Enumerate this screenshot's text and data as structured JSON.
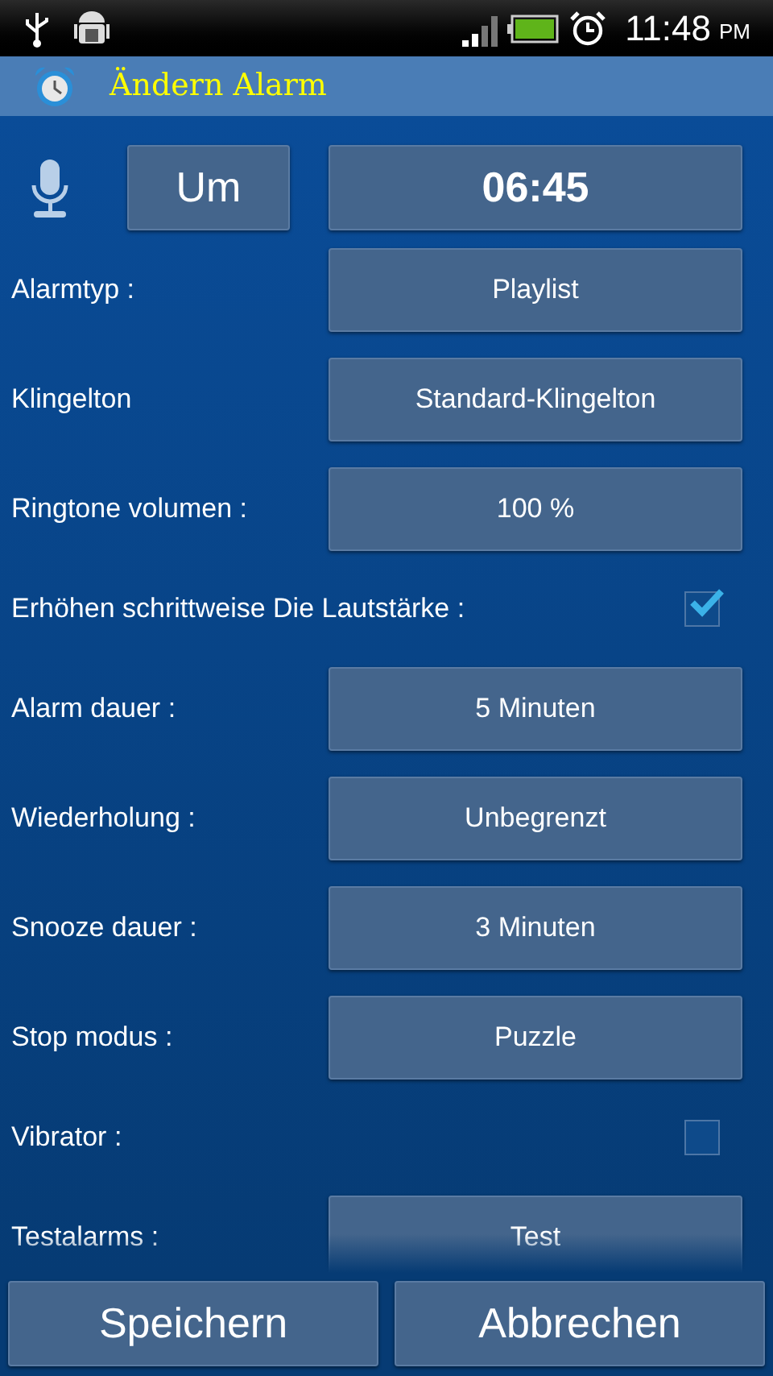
{
  "status_bar": {
    "time": "11:48",
    "ampm": "PM"
  },
  "title": "Ändern Alarm",
  "header": {
    "mode": "Um",
    "time": "06:45"
  },
  "rows": [
    {
      "kind": "button",
      "label": "Alarmtyp :",
      "value": "Playlist"
    },
    {
      "kind": "button",
      "label": "Klingelton",
      "value": "Standard-Klingelton"
    },
    {
      "kind": "button",
      "label": "Ringtone volumen :",
      "value": "100 %"
    },
    {
      "kind": "checkbox",
      "label": "Erhöhen schrittweise Die Lautstärke :",
      "checked": true
    },
    {
      "kind": "button",
      "label": "Alarm dauer :",
      "value": "5 Minuten"
    },
    {
      "kind": "button",
      "label": "Wiederholung :",
      "value": "Unbegrenzt"
    },
    {
      "kind": "button",
      "label": "Snooze dauer :",
      "value": "3 Minuten"
    },
    {
      "kind": "button",
      "label": "Stop modus :",
      "value": "Puzzle"
    },
    {
      "kind": "checkbox",
      "label": "Vibrator :",
      "checked": false
    },
    {
      "kind": "button",
      "label": "Testalarms :",
      "value": "Test"
    }
  ],
  "buttons": [
    "Speichern",
    "Abbrechen"
  ]
}
